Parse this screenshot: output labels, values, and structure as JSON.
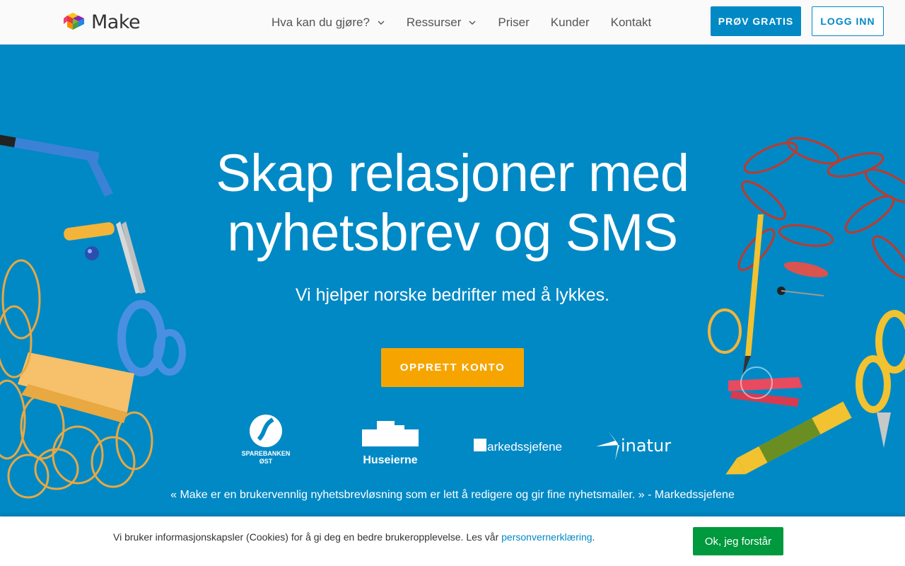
{
  "brand": {
    "name": "Make"
  },
  "nav": {
    "items": [
      {
        "label": "Hva kan du gjøre?",
        "dropdown": true
      },
      {
        "label": "Ressurser",
        "dropdown": true
      },
      {
        "label": "Priser",
        "dropdown": false
      },
      {
        "label": "Kunder",
        "dropdown": false
      },
      {
        "label": "Kontakt",
        "dropdown": false
      }
    ],
    "try_label": "PRØV GRATIS",
    "login_label": "LOGG INN"
  },
  "hero": {
    "headline_line1": "Skap relasjoner med",
    "headline_line2": "nyhetsbrev og SMS",
    "subline": "Vi hjelper norske bedrifter med å lykkes.",
    "cta_label": "OPPRETT KONTO",
    "customers": [
      {
        "name": "SPAREBANKEN",
        "sub": "ØST"
      },
      {
        "name": "Huseierne"
      },
      {
        "name": "markedssjefene"
      },
      {
        "name": "inatur"
      }
    ],
    "quote": "« Make er en brukervennlig nyhetsbrevløsning som er lett å redigere og gir fine nyhetsmailer. » - Markedssjefene"
  },
  "cookie": {
    "text": "Vi bruker informasjonskapsler (Cookies) for å gi deg en bedre brukeropplevelse. Les vår ",
    "link_label": "personvernerklæring",
    "end": ".",
    "ok_label": "Ok, jeg forstår"
  },
  "colors": {
    "primary": "#0089c5",
    "accent": "#f6a500",
    "ok_green": "#00993d"
  },
  "icons": {
    "logo": "make-cube-icon",
    "dropdown": "chevron-down-icon"
  }
}
